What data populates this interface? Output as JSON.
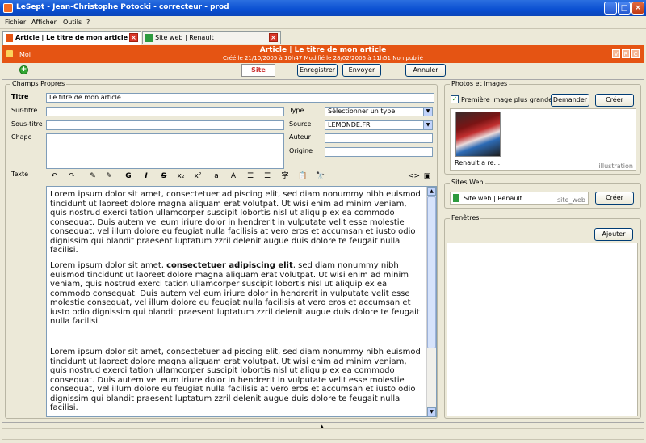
{
  "window": {
    "title": "LeSept - Jean-Christophe Potocki - correcteur - prod"
  },
  "menu": [
    "Fichier",
    "Afficher",
    "Outils",
    "?"
  ],
  "tabs": [
    {
      "label": "Article | Le titre de mon article",
      "active": true
    },
    {
      "label": "Site web | Renault",
      "active": false
    }
  ],
  "header": {
    "user": "Moi",
    "title": "Article | Le titre de mon article",
    "meta": "Créé le 21/10/2005 à 10h47    Modifié le 28/02/2006 à 11h51    Non publié",
    "vrc": [
      "V",
      "R",
      "C"
    ]
  },
  "actions": {
    "site": "Site",
    "save": "Enregistrer",
    "send": "Envoyer",
    "cancel": "Annuler"
  },
  "form": {
    "group_title": "Champs Propres",
    "titre_label": "Titre",
    "titre_value": "Le titre de mon article",
    "surtitre_label": "Sur-titre",
    "soustitre_label": "Sous-titre",
    "chapo_label": "Chapo",
    "type_label": "Type",
    "type_value": "Sélectionner un type",
    "source_label": "Source",
    "source_value": "LEMONDE.FR",
    "auteur_label": "Auteur",
    "origine_label": "Origine",
    "texte_label": "Texte"
  },
  "editor": {
    "toolbar_icons": [
      "undo-icon",
      "redo-icon",
      "spellcheck-icon",
      "spellcheck-alt-icon",
      "bold-icon",
      "italic-icon",
      "strikethrough-icon",
      "subscript-icon",
      "superscript-icon",
      "smaller-text-icon",
      "larger-text-icon",
      "numbered-list-icon",
      "bullet-list-icon",
      "special-char-icon",
      "paste-icon",
      "find-icon",
      "source-code-icon",
      "maximize-icon"
    ],
    "toolbar_glyphs": [
      "↶",
      "↷",
      "✎",
      "✎",
      "G",
      "I",
      "S",
      "x₂",
      "x²",
      "a",
      "A",
      "☰",
      "☰",
      "字",
      "📋",
      "🔭",
      "<>",
      "▣"
    ],
    "paragraph1": "Lorem ipsum dolor sit amet, consectetuer adipiscing elit, sed diam nonummy nibh euismod tincidunt ut laoreet dolore magna aliquam erat volutpat. Ut wisi enim ad minim veniam, quis nostrud exerci tation ullamcorper suscipit lobortis nisl ut aliquip ex ea commodo consequat. Duis autem vel eum iriure dolor in hendrerit in vulputate velit esse molestie consequat, vel illum dolore eu feugiat nulla facilisis at vero eros et accumsan et iusto odio dignissim qui blandit praesent luptatum zzril delenit augue duis dolore te feugait nulla facilisi.",
    "paragraph2_start": "Lorem ipsum dolor sit amet, ",
    "paragraph2_bold": "consectetuer adipiscing elit",
    "paragraph2_end": ", sed diam nonummy nibh euismod tincidunt ut laoreet dolore magna aliquam erat volutpat. Ut wisi enim ad minim veniam, quis nostrud exerci tation ullamcorper suscipit lobortis nisl ut aliquip ex ea commodo consequat. Duis autem vel eum iriure dolor in hendrerit in vulputate velit esse molestie consequat, vel illum dolore eu feugiat nulla facilisis at vero eros et accumsan et iusto odio dignissim qui blandit praesent luptatum zzril delenit augue duis dolore te feugait nulla facilisi.",
    "paragraph3": "Lorem ipsum dolor sit amet, consectetuer adipiscing elit, sed diam nonummy nibh euismod tincidunt ut laoreet dolore magna aliquam erat volutpat. Ut wisi enim ad minim veniam, quis nostrud exerci tation ullamcorper suscipit lobortis nisl ut aliquip ex ea commodo consequat. Duis autem vel eum iriure dolor in hendrerit in vulputate velit esse molestie consequat, vel illum dolore eu feugiat nulla facilisis at vero eros et accumsan et iusto odio dignissim qui blandit praesent luptatum zzril delenit augue duis dolore te feugait nulla facilisi."
  },
  "photos": {
    "title": "Photos et images",
    "first_image_label": "Première image plus grande",
    "first_image_checked": true,
    "request_button": "Demander",
    "create_button": "Créer",
    "image_caption": "Renault a re...",
    "image_tag": "illustration"
  },
  "sites": {
    "title": "Sites Web",
    "item_label": "Site web | Renault",
    "item_tag": "site_web",
    "create_button": "Créer"
  },
  "windows": {
    "title": "Fenêtres",
    "add_button": "Ajouter"
  }
}
